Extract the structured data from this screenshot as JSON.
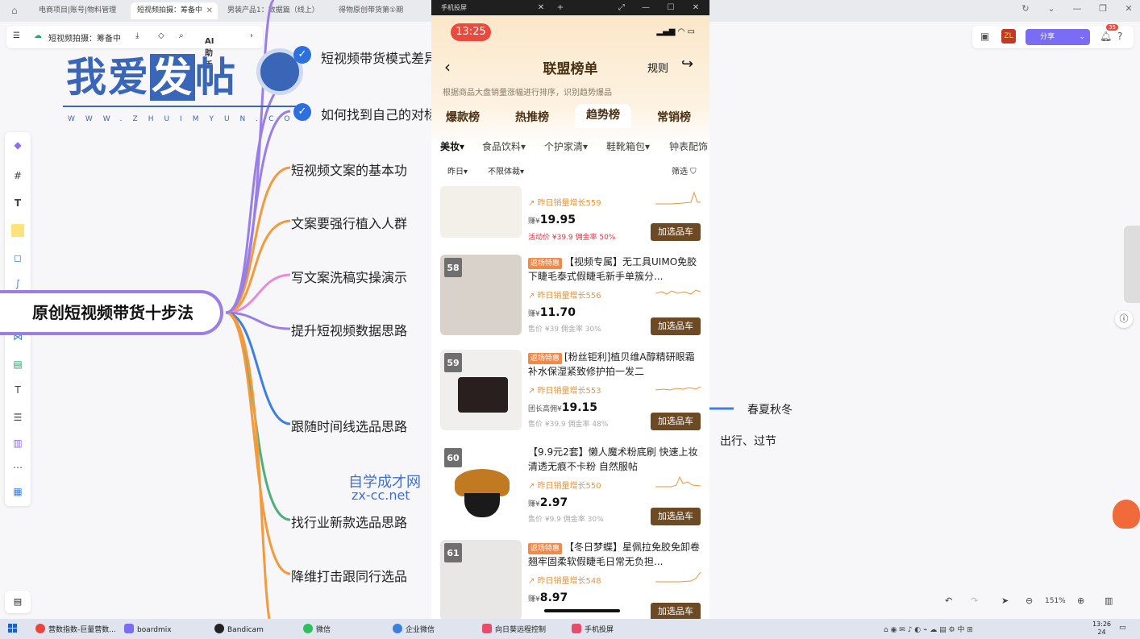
{
  "browser": {
    "tabs": [
      {
        "label": "电商项目|账号|物料管理"
      },
      {
        "label": "短视频拍摄：筹备中"
      },
      {
        "label": "男装产品1：数据篇（线上）"
      },
      {
        "label": "得物原创带货第①期"
      }
    ]
  },
  "app": {
    "doc_title": "短视频拍摄：筹备中",
    "ai_label": "AI助手",
    "share_label": "分享",
    "notif_count": "35",
    "zoom": "151%"
  },
  "mindmap": {
    "root": "原创短视频带货十步法",
    "branches": [
      "短视频带货模式差异",
      "如何找到自己的对标",
      "短视频文案的基本功",
      "文案要强行植入人群",
      "写文案洗稿实操演示",
      "提升短视频数据思路",
      "跟随时间线选品思路",
      "找行业新款选品思路",
      "降维打击跟同行选品"
    ],
    "sub_nodes": [
      "春夏秋冬",
      "出行、过节"
    ]
  },
  "watermarks": {
    "logo_text_a": "我爱",
    "logo_text_hl": "发",
    "logo_text_b": "帖",
    "logo_url": "WWW.ZHUIMYUN.COM",
    "site_a": "自学成才网",
    "site_b": "zx-cc.net"
  },
  "phone": {
    "window_title": "手机投屏",
    "time": "13:25",
    "page_title": "联盟榜单",
    "rule_label": "规则",
    "subtitle": "根据商品大盘销量涨幅进行排序，识别趋势爆品",
    "tabs": [
      "爆款榜",
      "热推榜",
      "趋势榜",
      "常销榜"
    ],
    "active_tab": "趋势榜",
    "categories": [
      "美妆",
      "食品饮料",
      "个护家清",
      "鞋靴箱包",
      "钟表配饰"
    ],
    "filters": {
      "date": "昨日",
      "format": "不限体裁",
      "screen": "筛选"
    },
    "items": [
      {
        "rank": "",
        "tag": "",
        "name": "",
        "growth": "昨日销量增长559",
        "price_prefix": "赚¥",
        "price": "19.95",
        "meta": "活动价 ¥39.9  佣金率 50%",
        "add": "加选品车"
      },
      {
        "rank": "58",
        "tag": "返场特惠",
        "name": "【视频专属】无工具UIMO免胶下睫毛泰式假睫毛新手单簇分...",
        "growth": "昨日销量增长556",
        "price_prefix": "赚¥",
        "price": "11.70",
        "meta": "售价 ¥39  佣金率 30%",
        "add": "加选品车"
      },
      {
        "rank": "59",
        "tag": "返场特惠",
        "name": "[粉丝钜利]植贝维A醇精研眼霜补水保湿紧致修护拍一发二",
        "growth": "昨日销量增长553",
        "price_prefix": "团长高佣¥",
        "price": "19.15",
        "meta": "售价 ¥39.9  佣金率 48%",
        "add": "加选品车"
      },
      {
        "rank": "60",
        "tag": "",
        "name": "【9.9元2套】懒人魔术粉底刷 快速上妆 清透无痕不卡粉 自然服帖",
        "growth": "昨日销量增长550",
        "price_prefix": "赚¥",
        "price": "2.97",
        "meta": "售价 ¥9.9  佣金率 30%",
        "add": "加选品车"
      },
      {
        "rank": "61",
        "tag": "返场特惠",
        "name": "【冬日梦蝶】星佩拉免胶免卸卷翘牢固柔软假睫毛日常无负担...",
        "growth": "昨日销量增长548",
        "price_prefix": "赚¥",
        "price": "8.97",
        "meta": "",
        "add": "加选品车"
      }
    ]
  },
  "taskbar": {
    "items": [
      "营数指数-巨量营数...",
      "boardmix",
      "Bandicam",
      "微信",
      "企业微信",
      "向日葵远程控制",
      "手机投屏"
    ],
    "time": "13:26",
    "date": "24"
  },
  "colors": {
    "branch_purple": "#9a7ee8",
    "branch_green": "#4caf7c",
    "branch_orange": "#f29a3c",
    "branch_pink": "#e98ad8",
    "branch_blue": "#3d7fe0",
    "phone_brown": "#6d4a24",
    "time_red": "#e84a3d"
  }
}
